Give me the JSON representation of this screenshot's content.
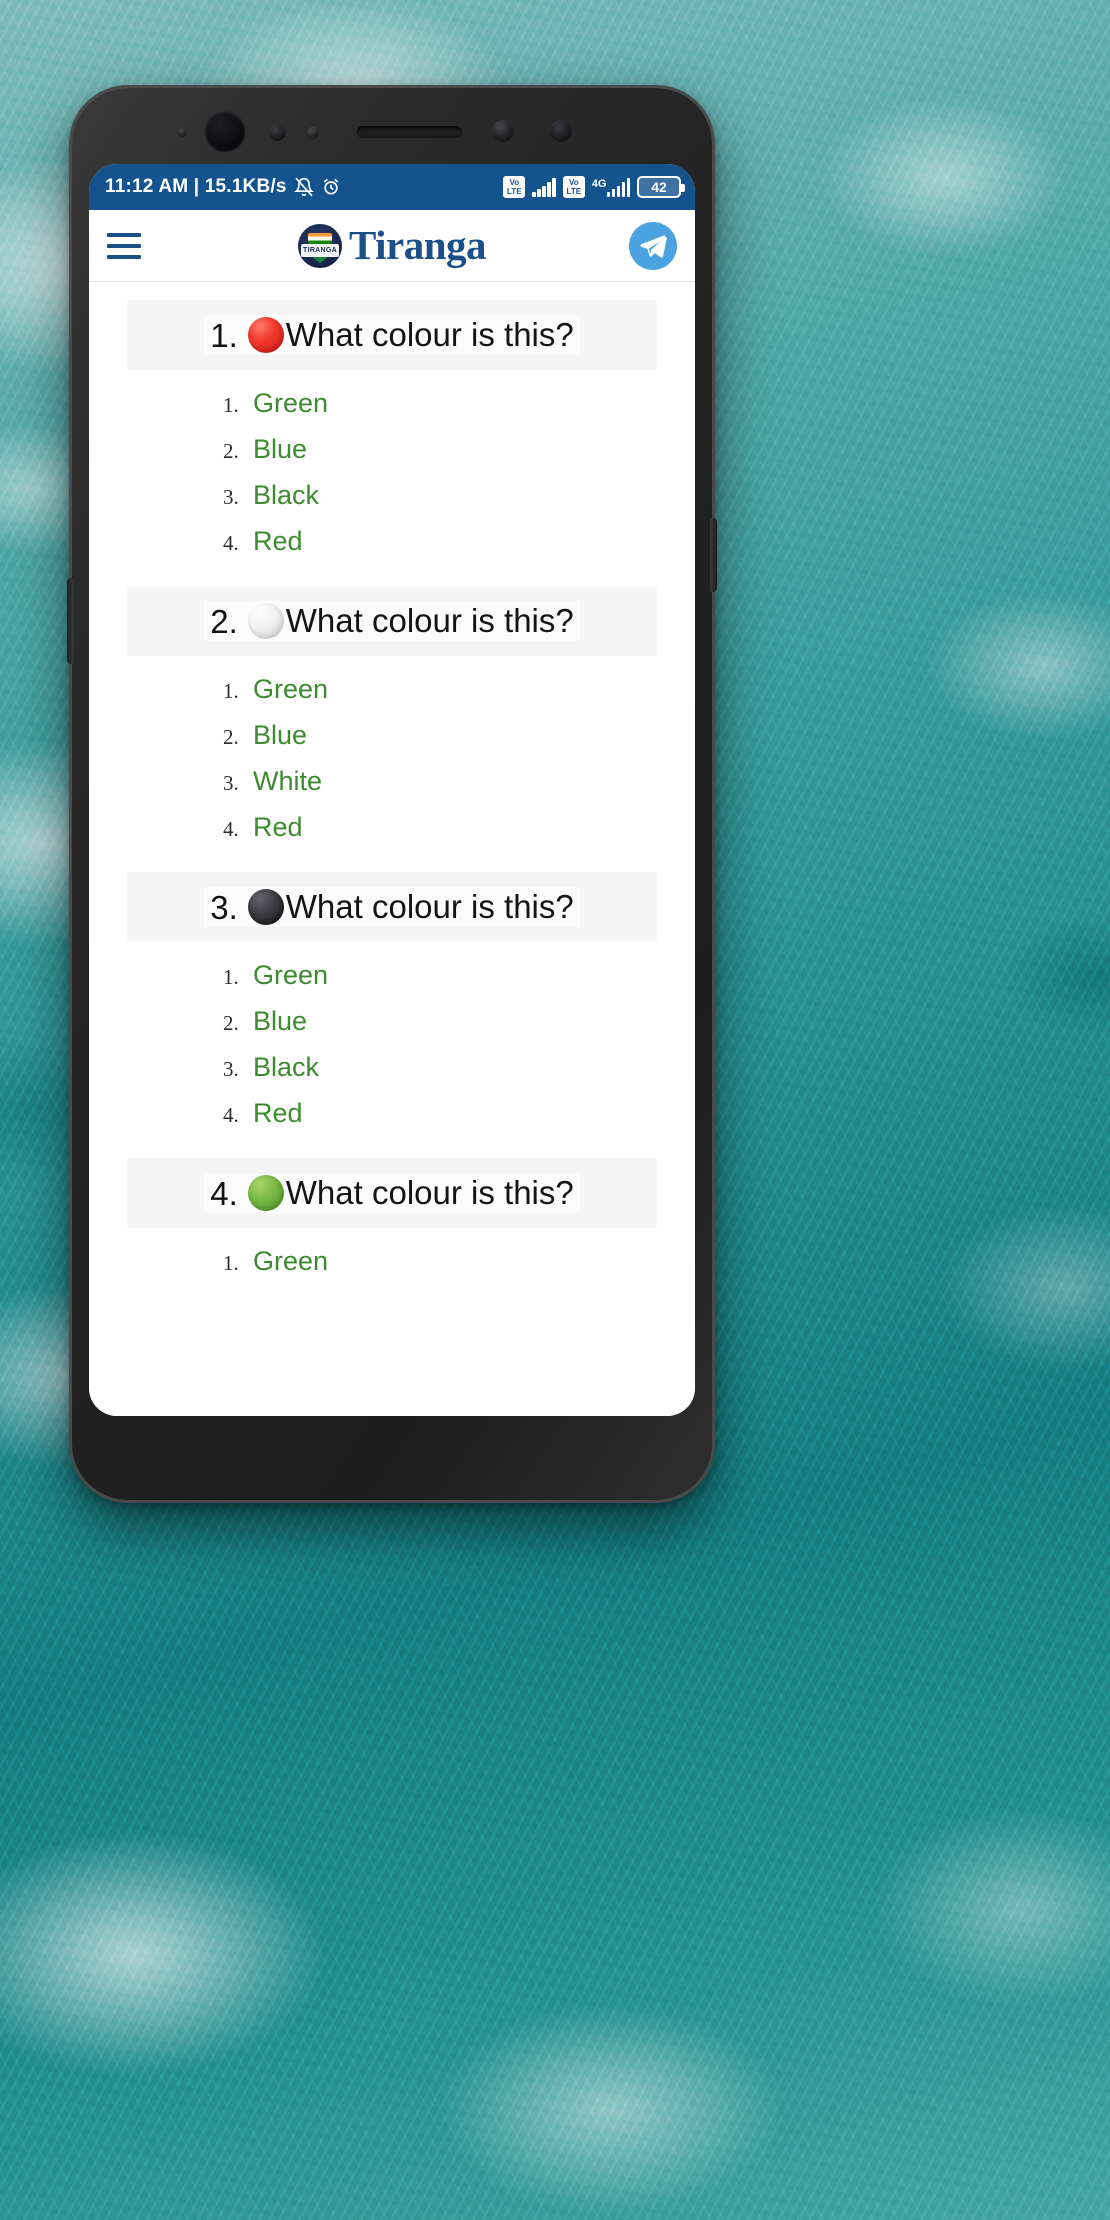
{
  "status_bar": {
    "time_and_speed": "11:12 AM | 15.1KB/s",
    "mute_icon": "bell-muted-icon",
    "alarm_icon": "alarm-clock-icon",
    "sim1_volte": "VoLTE",
    "sim1_volte_line1": "Vo",
    "sim1_volte_line2": "LTE",
    "sim2_volte_line1": "Vo",
    "sim2_volte_line2": "LTE",
    "network_type": "4G",
    "battery_percent": "42",
    "background_color": "#15538f"
  },
  "app_header": {
    "menu_icon": "hamburger-menu-icon",
    "logo_text": "TIRANGA",
    "brand_name": "Tiranga",
    "brand_color": "#1b4f8a",
    "telegram_icon": "telegram-icon",
    "telegram_color": "#4aa3e0"
  },
  "questions": [
    {
      "number": "1.",
      "swatch": "red-circle",
      "swatch_color": "#f0382c",
      "text": "What colour is this?",
      "options": [
        {
          "num": "1.",
          "label": "Green"
        },
        {
          "num": "2.",
          "label": "Blue"
        },
        {
          "num": "3.",
          "label": "Black"
        },
        {
          "num": "4.",
          "label": "Red"
        }
      ]
    },
    {
      "number": "2.",
      "swatch": "white-circle",
      "swatch_color": "#f0f0f0",
      "text": "What colour is this?",
      "options": [
        {
          "num": "1.",
          "label": "Green"
        },
        {
          "num": "2.",
          "label": "Blue"
        },
        {
          "num": "3.",
          "label": "White"
        },
        {
          "num": "4.",
          "label": "Red"
        }
      ]
    },
    {
      "number": "3.",
      "swatch": "black-circle",
      "swatch_color": "#3c3c42",
      "text": "What colour is this?",
      "options": [
        {
          "num": "1.",
          "label": "Green"
        },
        {
          "num": "2.",
          "label": "Blue"
        },
        {
          "num": "3.",
          "label": "Black"
        },
        {
          "num": "4.",
          "label": "Red"
        }
      ]
    },
    {
      "number": "4.",
      "swatch": "green-circle",
      "swatch_color": "#78b943",
      "text": "What colour is this?",
      "options": [
        {
          "num": "1.",
          "label": "Green"
        }
      ]
    }
  ],
  "link_color": "#3d8b2f"
}
